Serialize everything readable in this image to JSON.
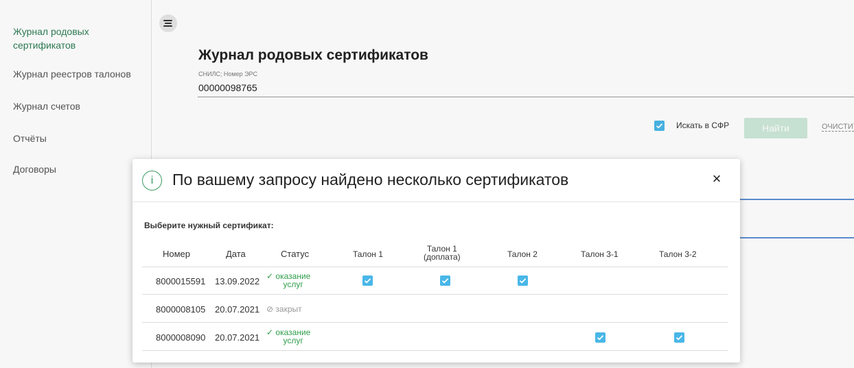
{
  "sidebar": {
    "items": [
      {
        "label": "Журнал родовых сертификатов",
        "line1": "Журнал родовых",
        "line2": "сертификатов"
      },
      {
        "label": "Журнал реестров талонов"
      },
      {
        "label": "Журнал счетов"
      },
      {
        "label": "Отчёты"
      },
      {
        "label": "Договоры"
      }
    ],
    "active_color": "#2e7d55"
  },
  "page": {
    "title": "Журнал родовых сертификатов",
    "search_label": "СНИЛС; Номер ЭРС",
    "search_value": "00000098765",
    "sfr_checkbox_label": "Искать в СФР",
    "sfr_checked": true,
    "find_button": "Найти",
    "clear_link": "ОЧИСТИТЬ"
  },
  "modal": {
    "title": "По вашему запросу найдено несколько сертификатов",
    "info_icon": "info-icon",
    "close_label": "×",
    "subtitle": "Выберите нужный сертификат:",
    "columns": [
      "Номер",
      "Дата",
      "Статус",
      "Талон 1",
      "Талон 1 (доплата)",
      "Талон 2",
      "Талон 3-1",
      "Талон 3-2"
    ],
    "column_talon1_dop_line1": "Талон 1",
    "column_talon1_dop_line2": "(доплата)",
    "rows": [
      {
        "number": "8000015591",
        "date": "13.09.2022",
        "status_l1": "оказание",
        "status_l2": "услуг",
        "status_type": "ok",
        "t1": true,
        "t1d": true,
        "t2": true,
        "t31": false,
        "t32": false
      },
      {
        "number": "8000008105",
        "date": "20.07.2021",
        "status_l1": "закрыт",
        "status_l2": "",
        "status_type": "closed",
        "t1": false,
        "t1d": false,
        "t2": false,
        "t31": false,
        "t32": false
      },
      {
        "number": "8000008090",
        "date": "20.07.2021",
        "status_l1": "оказание",
        "status_l2": "услуг",
        "status_type": "ok",
        "t1": false,
        "t1d": false,
        "t2": false,
        "t31": true,
        "t32": true
      }
    ]
  },
  "colors": {
    "accent_green": "#2e9e4a",
    "checkbox_blue": "#49b7e8"
  }
}
